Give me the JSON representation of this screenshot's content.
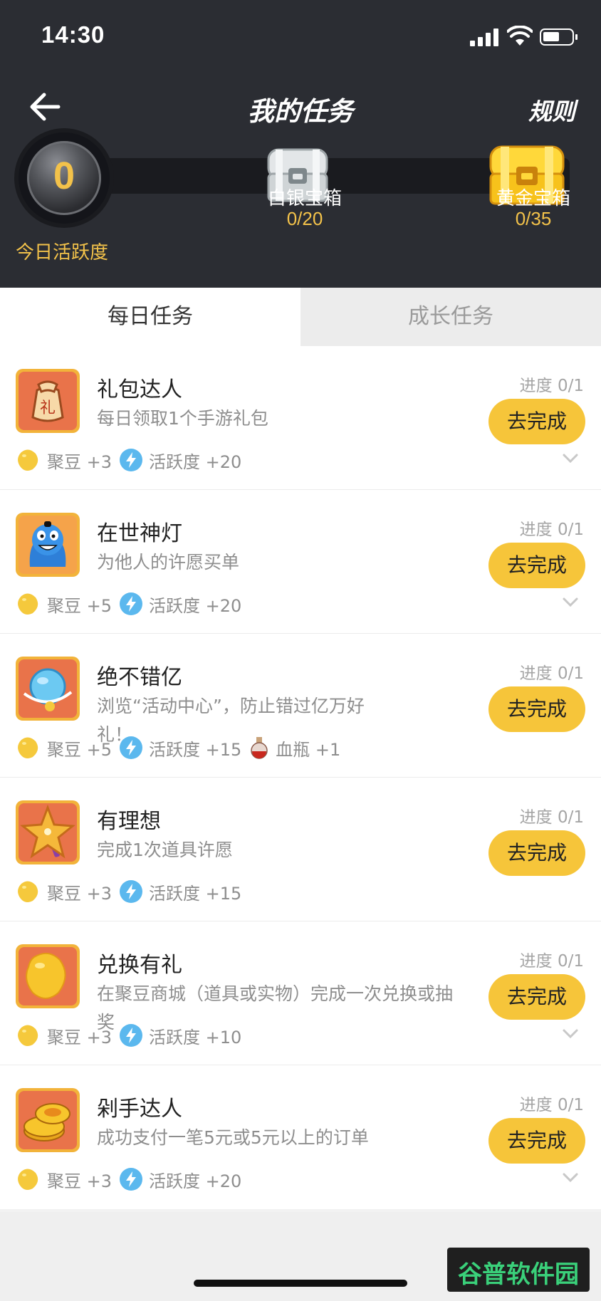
{
  "status_bar": {
    "time": "14:30"
  },
  "nav": {
    "title": "我的任务",
    "rules_label": "规则"
  },
  "activity": {
    "value": "0",
    "label": "今日活跃度"
  },
  "chests": [
    {
      "name": "白银宝箱",
      "count": "0/20"
    },
    {
      "name": "黄金宝箱",
      "count": "0/35"
    }
  ],
  "tabs": [
    {
      "label": "每日任务",
      "selected": true
    },
    {
      "label": "成长任务",
      "selected": false
    }
  ],
  "tasks": [
    {
      "title": "礼包达人",
      "desc": "每日领取1个手游礼包",
      "progress": "进度 0/1",
      "button": "去完成",
      "rewards": [
        {
          "icon": "bean-icon",
          "text": "聚豆 +3"
        },
        {
          "icon": "activity-icon",
          "text": "活跃度 +20"
        }
      ]
    },
    {
      "title": "在世神灯",
      "desc": "为他人的许愿买单",
      "progress": "进度 0/1",
      "button": "去完成",
      "rewards": [
        {
          "icon": "bean-icon",
          "text": "聚豆 +5"
        },
        {
          "icon": "activity-icon",
          "text": "活跃度 +20"
        }
      ]
    },
    {
      "title": "绝不错亿",
      "desc": "浏览“活动中心”，防止错过亿万好礼！",
      "progress": "进度 0/1",
      "button": "去完成",
      "rewards": [
        {
          "icon": "bean-icon",
          "text": "聚豆 +5"
        },
        {
          "icon": "activity-icon",
          "text": "活跃度 +15"
        },
        {
          "icon": "potion-icon",
          "text": "血瓶 +1"
        }
      ]
    },
    {
      "title": "有理想",
      "desc": "完成1次道具许愿",
      "progress": "进度 0/1",
      "button": "去完成",
      "rewards": [
        {
          "icon": "bean-icon",
          "text": "聚豆 +3"
        },
        {
          "icon": "activity-icon",
          "text": "活跃度 +15"
        }
      ]
    },
    {
      "title": "兑换有礼",
      "desc": "在聚豆商城（道具或实物）完成一次兑换或抽奖",
      "progress": "进度 0/1",
      "button": "去完成",
      "rewards": [
        {
          "icon": "bean-icon",
          "text": "聚豆 +3"
        },
        {
          "icon": "activity-icon",
          "text": "活跃度 +10"
        }
      ]
    },
    {
      "title": "剁手达人",
      "desc": "成功支付一笔5元或5元以上的订单",
      "progress": "进度 0/1",
      "button": "去完成",
      "rewards": [
        {
          "icon": "bean-icon",
          "text": "聚豆 +3"
        },
        {
          "icon": "activity-icon",
          "text": "活跃度 +20"
        }
      ]
    }
  ],
  "watermark": "谷普软件园",
  "colors": {
    "header_bg": "#2b2d33",
    "accent_yellow": "#f6c53a",
    "gold_text": "#f3c24a"
  }
}
